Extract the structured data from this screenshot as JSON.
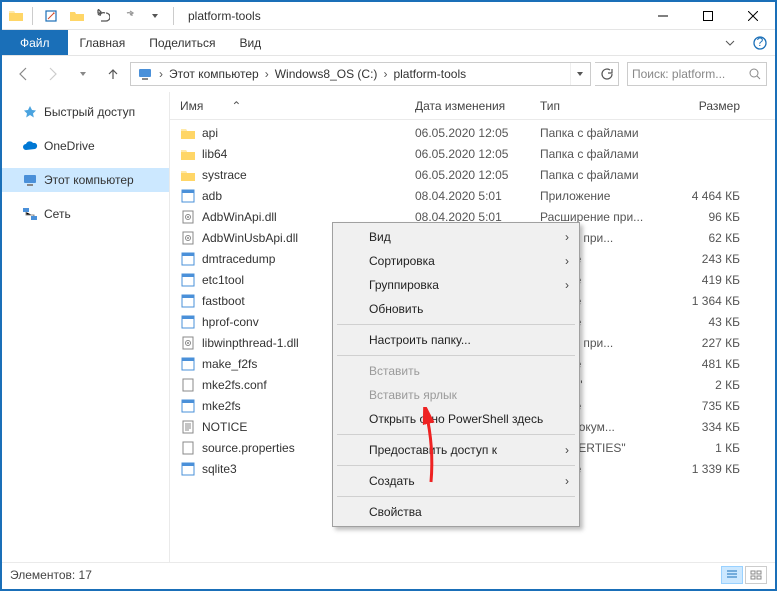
{
  "titlebar": {
    "title": "platform-tools"
  },
  "ribbon": {
    "file": "Файл",
    "home": "Главная",
    "share": "Поделиться",
    "view": "Вид"
  },
  "breadcrumb": {
    "segments": [
      "Этот компьютер",
      "Windows8_OS (C:)",
      "platform-tools"
    ]
  },
  "search": {
    "placeholder": "Поиск: platform..."
  },
  "sidebar": {
    "quick_access": "Быстрый доступ",
    "onedrive": "OneDrive",
    "this_pc": "Этот компьютер",
    "network": "Сеть"
  },
  "columns": {
    "name": "Имя",
    "date": "Дата изменения",
    "type": "Тип",
    "size": "Размер"
  },
  "files": [
    {
      "name": "api",
      "date": "06.05.2020 12:05",
      "type": "Папка с файлами",
      "size": "",
      "kind": "folder"
    },
    {
      "name": "lib64",
      "date": "06.05.2020 12:05",
      "type": "Папка с файлами",
      "size": "",
      "kind": "folder"
    },
    {
      "name": "systrace",
      "date": "06.05.2020 12:05",
      "type": "Папка с файлами",
      "size": "",
      "kind": "folder"
    },
    {
      "name": "adb",
      "date": "08.04.2020 5:01",
      "type": "Приложение",
      "size": "4 464 КБ",
      "kind": "exe"
    },
    {
      "name": "AdbWinApi.dll",
      "date": "08.04.2020 5:01",
      "type": "Расширение при...",
      "size": "96 КБ",
      "kind": "dll"
    },
    {
      "name": "AdbWinUsbApi.dll",
      "date": "",
      "type": "ирение при...",
      "size": "62 КБ",
      "kind": "dll"
    },
    {
      "name": "dmtracedump",
      "date": "",
      "type": "ожение",
      "size": "243 КБ",
      "kind": "exe"
    },
    {
      "name": "etc1tool",
      "date": "",
      "type": "ожение",
      "size": "419 КБ",
      "kind": "exe"
    },
    {
      "name": "fastboot",
      "date": "",
      "type": "ожение",
      "size": "1 364 КБ",
      "kind": "exe"
    },
    {
      "name": "hprof-conv",
      "date": "",
      "type": "ожение",
      "size": "43 КБ",
      "kind": "exe"
    },
    {
      "name": "libwinpthread-1.dll",
      "date": "",
      "type": "ирение при...",
      "size": "227 КБ",
      "kind": "dll"
    },
    {
      "name": "make_f2fs",
      "date": "",
      "type": "ожение",
      "size": "481 КБ",
      "kind": "exe"
    },
    {
      "name": "mke2fs.conf",
      "date": "",
      "type": "\"CONF\"",
      "size": "2 КБ",
      "kind": "file"
    },
    {
      "name": "mke2fs",
      "date": "",
      "type": "ожение",
      "size": "735 КБ",
      "kind": "exe"
    },
    {
      "name": "NOTICE",
      "date": "",
      "type": "овый докум...",
      "size": "334 КБ",
      "kind": "txt"
    },
    {
      "name": "source.properties",
      "date": "",
      "type": "\"PROPERTIES\"",
      "size": "1 КБ",
      "kind": "file"
    },
    {
      "name": "sqlite3",
      "date": "",
      "type": "ожение",
      "size": "1 339 КБ",
      "kind": "exe"
    }
  ],
  "context_menu": {
    "view": "Вид",
    "sort": "Сортировка",
    "group": "Группировка",
    "refresh": "Обновить",
    "customize": "Настроить папку...",
    "paste": "Вставить",
    "paste_shortcut": "Вставить ярлык",
    "powershell": "Открыть окно PowerShell здесь",
    "give_access": "Предоставить доступ к",
    "create": "Создать",
    "properties": "Свойства"
  },
  "status": {
    "count": "Элементов: 17"
  }
}
